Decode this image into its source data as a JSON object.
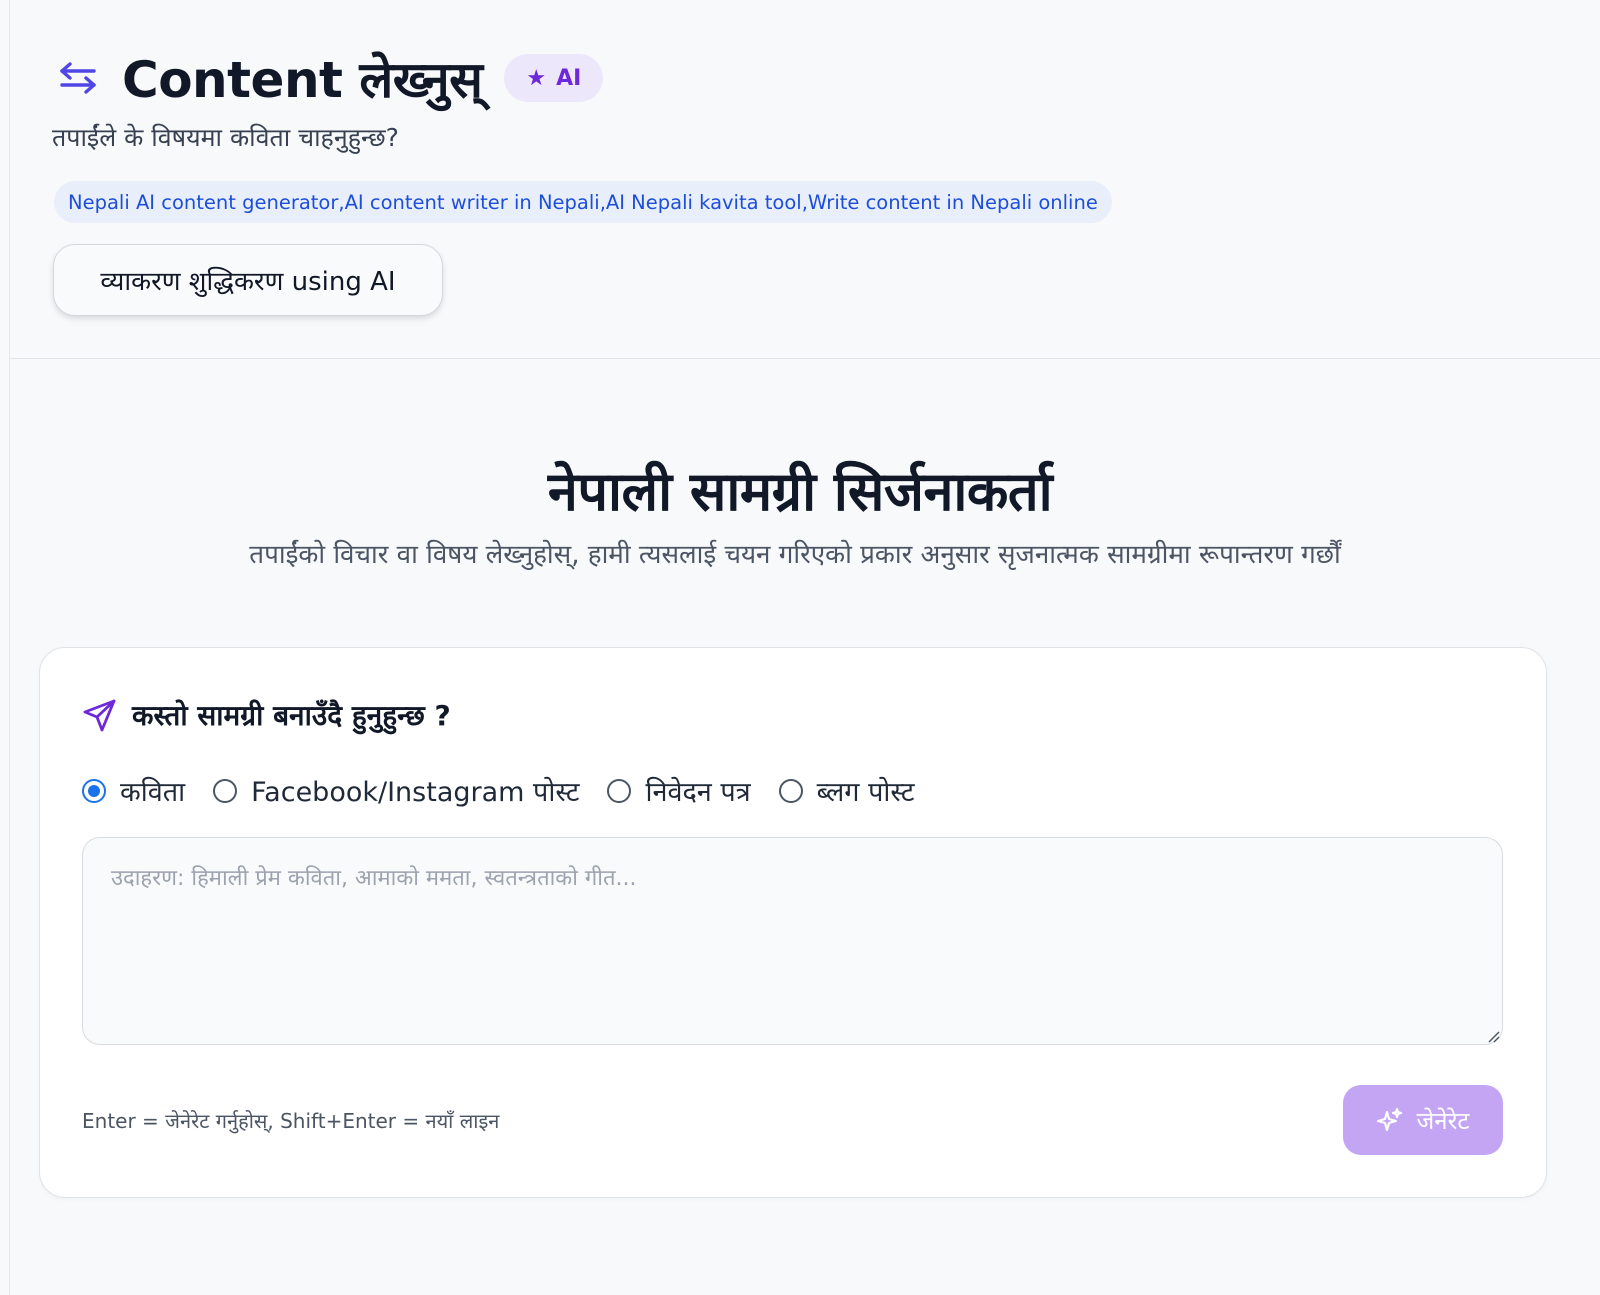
{
  "header": {
    "title": "Content लेख्नुस्",
    "ai_badge": "AI",
    "subtitle": "तपाईंले के विषयमा कविता चाहनुहुन्छ?",
    "keywords": "Nepali AI content generator,AI content writer in Nepali,AI Nepali kavita tool,Write content in Nepali online",
    "grammar_button": "व्याकरण शुद्धिकरण using AI"
  },
  "main": {
    "heading": "नेपाली सामग्री सिर्जनाकर्ता",
    "description": "तपाईंको विचार वा विषय लेख्नुहोस्, हामी त्यसलाई चयन गरिएको प्रकार अनुसार सृजनात्मक सामग्रीमा रूपान्तरण गर्छौं"
  },
  "form": {
    "question": "कस्तो सामग्री बनाउँदै हुनुहुन्छ ?",
    "options": [
      {
        "label": "कविता",
        "selected": true
      },
      {
        "label": "Facebook/Instagram पोस्ट",
        "selected": false
      },
      {
        "label": "निवेदन पत्र",
        "selected": false
      },
      {
        "label": "ब्लग पोस्ट",
        "selected": false
      }
    ],
    "input_value": "",
    "input_placeholder": "उदाहरण: हिमाली प्रेम कविता, आमाको ममता, स्वतन्त्रताको गीत...",
    "hint": "Enter = जेनेरेट गर्नुहोस्, Shift+Enter = नयाँ लाइन",
    "generate_button": "जेनेरेट"
  },
  "colors": {
    "accent": "#6d28d9",
    "radio_selected": "#1a73e8",
    "generate_button": "#c3a5f4",
    "keyword_text": "#1d4ed8"
  },
  "icons": {
    "swap": "swap-arrows-icon",
    "badge": "star-icon",
    "send": "send-icon",
    "generate": "sparkles-icon"
  }
}
